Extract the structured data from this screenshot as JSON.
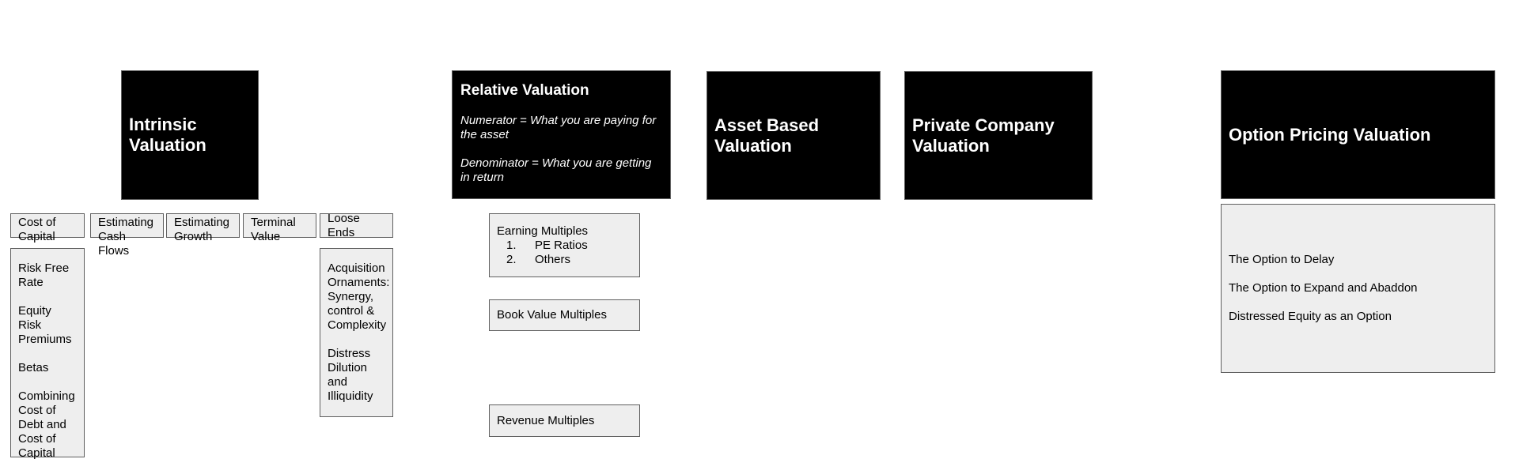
{
  "intrinsic": {
    "title": "Intrinsic Valuation",
    "categories": [
      {
        "label": "Cost of Capital"
      },
      {
        "label": "Estimating Cash Flows"
      },
      {
        "label": "Estimating Growth"
      },
      {
        "label": "Terminal Value"
      },
      {
        "label": "Loose Ends"
      }
    ],
    "cost_of_capital_items": [
      "Risk Free Rate",
      "Equity Risk Premiums",
      "Betas",
      "Combining Cost of Debt and Cost of Capital"
    ],
    "loose_ends_items": [
      "Acquisition Ornaments: Synergy, control & Complexity",
      "Distress Dilution and Illiquidity"
    ]
  },
  "relative": {
    "title": "Relative Valuation",
    "numerator": "Numerator = What you are paying for the asset",
    "denominator": "Denominator = What you are getting in return",
    "earning_multiples": {
      "label": "Earning Multiples",
      "items": [
        {
          "num": "1.",
          "label": "PE Ratios"
        },
        {
          "num": "2.",
          "label": "Others"
        }
      ]
    },
    "book_value_multiples": "Book Value Multiples",
    "revenue_multiples": "Revenue Multiples"
  },
  "asset_based": {
    "title": "Asset Based Valuation"
  },
  "private_company": {
    "title": "Private Company Valuation"
  },
  "option_pricing": {
    "title": "Option Pricing Valuation",
    "items": [
      "The Option to Delay",
      "The Option to Expand and Abaddon",
      "Distressed Equity as an Option"
    ]
  }
}
